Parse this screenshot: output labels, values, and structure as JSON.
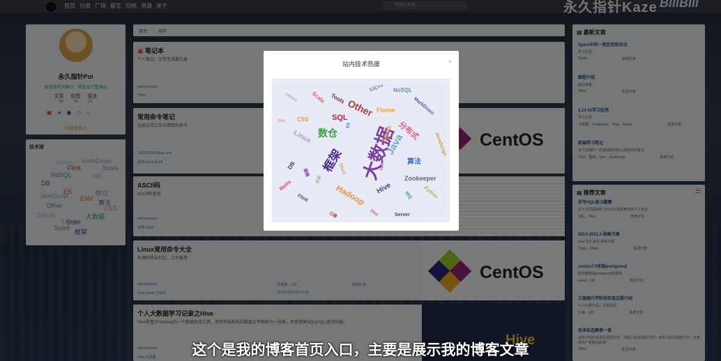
{
  "nav": [
    "首页",
    "分类",
    "广场",
    "留言",
    "归档",
    "资源",
    "关于"
  ],
  "search_placeholder": "请输入搜索",
  "brand": "永久指针Kaze",
  "brand2": "BiliBili",
  "profile": {
    "name": "永久指针Poi",
    "motto": "敢逆黄河冰寨川，将登太行雪满山",
    "stats": [
      "文章",
      "标签",
      "留言"
    ],
    "nums": [
      "88",
      "36",
      "33"
    ],
    "welcome": "欢迎留意点"
  },
  "tags_title": "技术球",
  "tag_words": [
    "HBase",
    "MarkDown",
    "Flink",
    "Scala",
    "NoSQL",
    "HA",
    "DB",
    "ES",
    "数仓",
    "ENV",
    "算法",
    "Other",
    "CSS",
    "Server",
    "大数据",
    "Linux",
    "Shell",
    "Spark",
    "框架",
    "JavaScript"
  ],
  "breadcrumb": {
    "home": "首页",
    "current": "推荐"
  },
  "posts": [
    {
      "title": "笔记本",
      "desc": "个人笔记、日常生活备忘录",
      "author": "administrator",
      "tags": "Other"
    },
    {
      "title": "常用命令笔记",
      "desc": "记录日常工作中用到的命令",
      "author": "1306550560@qq.com",
      "tags": "其他,Linux,Shell"
    },
    {
      "title": "ASCII码",
      "desc": "ASCII码查询",
      "author": "administrator",
      "tags": "资源,Other"
    },
    {
      "title": "Linux常用命令大全",
      "desc": "来源阿里云社区，工作备用",
      "author": "administrator",
      "tags": "Linux,Shell,分布式",
      "views": "阅读量：119",
      "date": "2022/11/02 08:37:19",
      "cat": "资源分享"
    },
    {
      "title": "个人大数据学习记录之Hive",
      "desc": "Hive是基于Hadoop的一个数据仓库工具，用来将结构化的数据文件映射为一张表，并提供类SQL(HQL)查询功能。",
      "author": "administrator",
      "tags": "Hive,大数据"
    }
  ],
  "centos": "CentOS",
  "hive": "Hive",
  "latest": {
    "title": "最新文章",
    "items": [
      {
        "t": "Spark中的一些区别知识点",
        "d": "学习记录",
        "a": "Spark",
        "c": "资源分享"
      },
      {
        "t": "面程介绍",
        "d": "面试准备",
        "a": "Other",
        "c": "生活日常"
      },
      {
        "t": "3.14-15学习任务",
        "d": "学习记录",
        "a": "大数据，Zookeeper，Hive，Flume",
        "c": "生活日常"
      },
      {
        "t": "前端学习笔记",
        "d": "关于前端的一些基础知识和三层结构的笔记",
        "a": "CSS，框架，Vue，JavaScript",
        "c": "技术讨论"
      }
    ]
  },
  "recommend": {
    "title": "推荐文章",
    "items": [
      {
        "t": "手写HQL练习题集",
        "d": "关于日常基础练习HQL的函数用法的个人笔记",
        "a": "SQL，Hive",
        "c": "技术讨论"
      },
      {
        "t": "IDEA 2021.3 破解方案",
        "d": "idea 永久激活 破解方案",
        "a": "Tools，Other",
        "c": "资源分享"
      },
      {
        "t": "centos7.9安装postgresql",
        "d": "服务器安装postgresql数据库",
        "a": "Linux，DB",
        "c": "技术讨论"
      },
      {
        "t": "三级跳升学阶段实现过程介绍",
        "d": "个人比赛作品、记录总结",
        "a": "三级，DIY",
        "c": "资源分享"
      },
      {
        "t": "毛泽东选集第一卷",
        "d": "战无不胜的毛泽东思想万岁！中国人民大团结万岁！世界人民大团结万岁！全世界无产者联合起来！",
        "a": "Other",
        "c": "生活日常"
      }
    ]
  },
  "modal": {
    "title": "站内技术热度",
    "close": "×",
    "words": [
      {
        "w": "大数据",
        "c": "#7b3fa0",
        "s": 26
      },
      {
        "w": "框架",
        "c": "#4a2a8a",
        "s": 17
      },
      {
        "w": "数仓",
        "c": "#3aa040",
        "s": 14
      },
      {
        "w": "Java",
        "c": "#6aa7c8",
        "s": 14
      },
      {
        "w": "Other",
        "c": "#a04040",
        "s": 14
      },
      {
        "w": "Hadoop",
        "c": "#f09040",
        "s": 12
      },
      {
        "w": "分布式",
        "c": "#e06080",
        "s": 11
      },
      {
        "w": "Zookeeper",
        "c": "#5a6a8a",
        "s": 9
      },
      {
        "w": "SQL",
        "c": "#c02040",
        "s": 11
      },
      {
        "w": "Flume",
        "c": "#f0a040",
        "s": 9
      },
      {
        "w": "Hive",
        "c": "#4a3a8a",
        "s": 10
      },
      {
        "w": "算法",
        "c": "#3a70c0",
        "s": 10
      },
      {
        "w": "Spark",
        "c": "#f0a040",
        "s": 9
      },
      {
        "w": "Linux",
        "c": "#a0a0c0",
        "s": 10
      },
      {
        "w": "CSS",
        "c": "#e0a040",
        "s": 8
      },
      {
        "w": "Tools",
        "c": "#5a3a3a",
        "s": 8
      },
      {
        "w": "Scala",
        "c": "#e06060",
        "s": 8
      },
      {
        "w": "NoSQL",
        "c": "#6a8ab0",
        "s": 8
      },
      {
        "w": "C/C++",
        "c": "#6a6a9a",
        "s": 7
      },
      {
        "w": "MarkDown",
        "c": "#5a5aa0",
        "s": 7
      },
      {
        "w": "JavaScript",
        "c": "#c0a040",
        "s": 7
      },
      {
        "w": "DB",
        "c": "#3a3a7a",
        "s": 8
      },
      {
        "w": "Shell",
        "c": "#e0a060",
        "s": 7
      },
      {
        "w": "Redis",
        "c": "#e04060",
        "s": 7
      },
      {
        "w": "Flink",
        "c": "#4a4a8a",
        "s": 7
      },
      {
        "w": "Python",
        "c": "#90c060",
        "s": 7
      },
      {
        "w": "Server",
        "c": "#4a3a8a",
        "s": 7
      },
      {
        "w": "MQ",
        "c": "#4aa080",
        "s": 7
      },
      {
        "w": "ES",
        "c": "#4a6aaa",
        "s": 6
      },
      {
        "w": "HBase",
        "c": "#b0b0d0",
        "s": 6
      },
      {
        "w": "Vue",
        "c": "#e0a0a0",
        "s": 6
      },
      {
        "w": "ENV",
        "c": "#d06080",
        "s": 6
      },
      {
        "w": "三级",
        "c": "#a03a3a",
        "s": 6
      },
      {
        "w": "面程",
        "c": "#7a3a9a",
        "s": 6
      },
      {
        "w": "HA",
        "c": "#9a4ac0",
        "s": 6
      },
      {
        "w": "资源",
        "c": "#a0c0a0",
        "s": 6
      }
    ]
  },
  "subtitle": "这个是我的博客首页入口，主要是展示我的博客文章"
}
